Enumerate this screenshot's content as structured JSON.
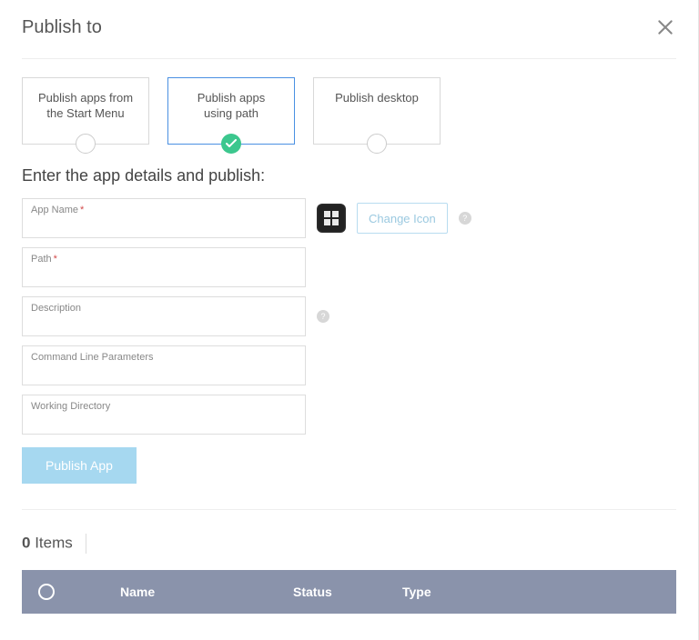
{
  "header": {
    "title": "Publish to"
  },
  "options": [
    {
      "label_line1": "Publish apps from",
      "label_line2": "the Start Menu",
      "selected": false
    },
    {
      "label_line1": "Publish apps",
      "label_line2": "using path",
      "selected": true
    },
    {
      "label_line1": "Publish desktop",
      "label_line2": "",
      "selected": false
    }
  ],
  "section_title": "Enter the app details and publish:",
  "fields": {
    "app_name": {
      "label": "App Name",
      "required": true,
      "value": ""
    },
    "path": {
      "label": "Path",
      "required": true,
      "value": ""
    },
    "description": {
      "label": "Description",
      "required": false,
      "value": ""
    },
    "cli_params": {
      "label": "Command Line Parameters",
      "required": false,
      "value": ""
    },
    "working_dir": {
      "label": "Working Directory",
      "required": false,
      "value": ""
    }
  },
  "change_icon_label": "Change Icon",
  "publish_button_label": "Publish App",
  "items": {
    "count": "0",
    "label": "Items"
  },
  "table": {
    "columns": {
      "name": "Name",
      "status": "Status",
      "type": "Type"
    },
    "rows": []
  },
  "help_char": "?"
}
